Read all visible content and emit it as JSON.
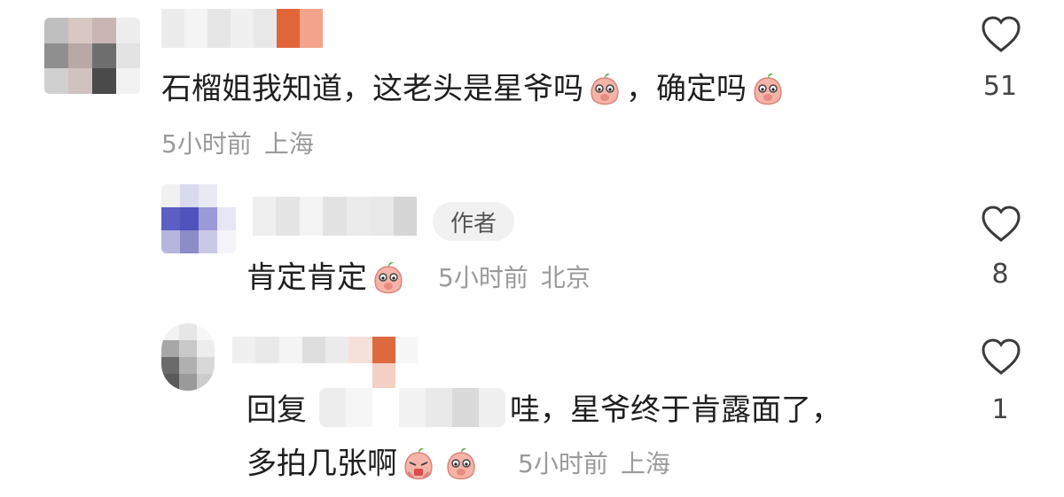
{
  "comments": [
    {
      "text_a": "石榴姐我知道，这老头是星爷吗",
      "text_b": "，确定吗",
      "time": "5小时前",
      "location": "上海",
      "likes": "51",
      "heart_icon": "heart-outline-icon"
    },
    {
      "author_badge": "作者",
      "text": "肯定肯定",
      "time": "5小时前",
      "location": "北京",
      "likes": "8",
      "heart_icon": "heart-outline-icon"
    },
    {
      "reply_prefix": "回复",
      "text_line1": "哇，星爷终于肯露面了，",
      "text_line2": "多拍几张啊",
      "time": "5小时前",
      "location": "上海",
      "likes": "1",
      "heart_icon": "heart-outline-icon"
    }
  ],
  "colors": {
    "text": "#1f1f1f",
    "meta": "#9a9a9a",
    "badge_bg": "#f1f1f1",
    "emoji_peach": "#f6b4a8"
  }
}
